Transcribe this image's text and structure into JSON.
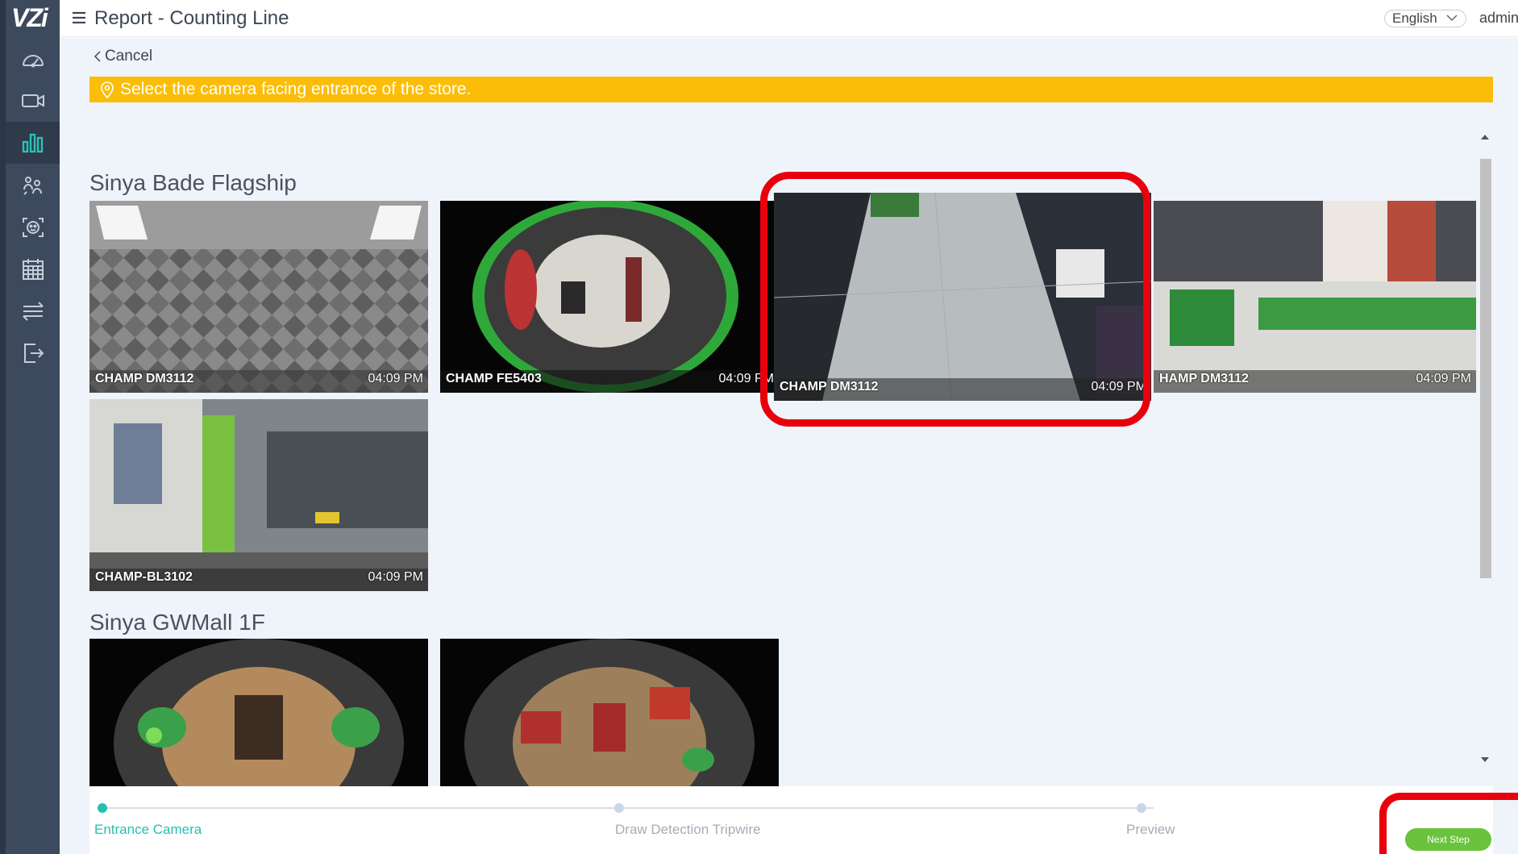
{
  "app": {
    "logo_text": "VZi",
    "page_title": "Report - Counting Line",
    "language": "English",
    "user": "admin"
  },
  "sidebar": {
    "items": [
      {
        "icon": "dashboard-gauge-icon",
        "active": false
      },
      {
        "icon": "video-camera-icon",
        "active": false
      },
      {
        "icon": "bar-chart-icon",
        "active": true
      },
      {
        "icon": "people-flow-icon",
        "active": false
      },
      {
        "icon": "face-recognition-icon",
        "active": false
      },
      {
        "icon": "calendar-icon",
        "active": false
      },
      {
        "icon": "transfer-arrows-icon",
        "active": false
      },
      {
        "icon": "logout-icon",
        "active": false
      }
    ]
  },
  "main": {
    "cancel_label": "Cancel",
    "banner_text": "Select the camera facing entrance of the store.",
    "groups": [
      {
        "name": "Sinya Bade Flagship",
        "cameras": [
          {
            "name": "CHAMP DM3112",
            "time": "04:09 PM"
          },
          {
            "name": "CHAMP FE5403",
            "time": "04:09 PM"
          },
          {
            "name": "CHAMP DM3112",
            "time": "04:09 PM"
          },
          {
            "name": "HAMP DM3112",
            "time": "04:09 PM"
          },
          {
            "name": "CHAMP-BL3102",
            "time": "04:09 PM"
          }
        ]
      },
      {
        "name": "Sinya GWMall 1F",
        "cameras": [
          {
            "name": "",
            "time": ""
          },
          {
            "name": "",
            "time": ""
          }
        ]
      }
    ]
  },
  "stepper": {
    "steps": [
      {
        "label": "Entrance Camera",
        "active": true
      },
      {
        "label": "Draw Detection Tripwire",
        "active": false
      },
      {
        "label": "Preview",
        "active": false
      }
    ],
    "next_label": "Next Step"
  },
  "colors": {
    "banner": "#fbbd08",
    "active_step": "#27c0b0",
    "next_button": "#69c33c",
    "annotation_red": "#e8000d",
    "sidebar": "#3d4a5e"
  }
}
